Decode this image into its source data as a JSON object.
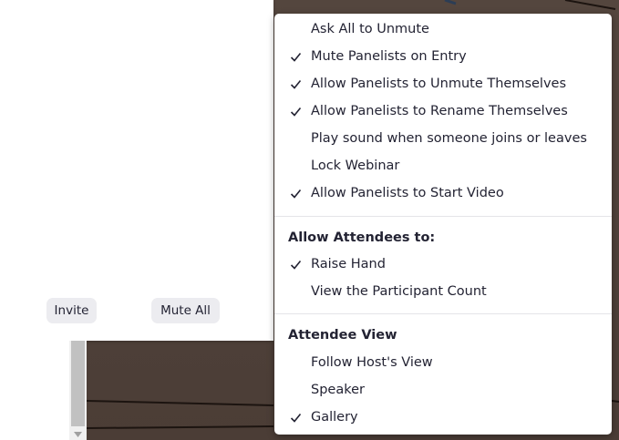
{
  "panel": {
    "invite_label": "Invite",
    "mute_all_label": "Mute All"
  },
  "menu": {
    "section1": [
      {
        "label": "Ask All to Unmute",
        "checked": false
      },
      {
        "label": "Mute Panelists on Entry",
        "checked": true
      },
      {
        "label": "Allow Panelists to Unmute Themselves",
        "checked": true
      },
      {
        "label": "Allow Panelists to Rename Themselves",
        "checked": true
      },
      {
        "label": "Play sound when someone joins or leaves",
        "checked": false
      },
      {
        "label": "Lock Webinar",
        "checked": false
      },
      {
        "label": "Allow Panelists to Start Video",
        "checked": true
      }
    ],
    "attendees_header": "Allow Attendees to:",
    "section2": [
      {
        "label": "Raise Hand",
        "checked": true
      },
      {
        "label": "View the Participant Count",
        "checked": false
      }
    ],
    "view_header": "Attendee View",
    "section3": [
      {
        "label": "Follow Host's View",
        "checked": false
      },
      {
        "label": "Speaker",
        "checked": false
      },
      {
        "label": "Gallery",
        "checked": true
      }
    ]
  },
  "colors": {
    "text": "#232333",
    "button_bg": "#ececf0",
    "video_bg": "#4e4038"
  }
}
